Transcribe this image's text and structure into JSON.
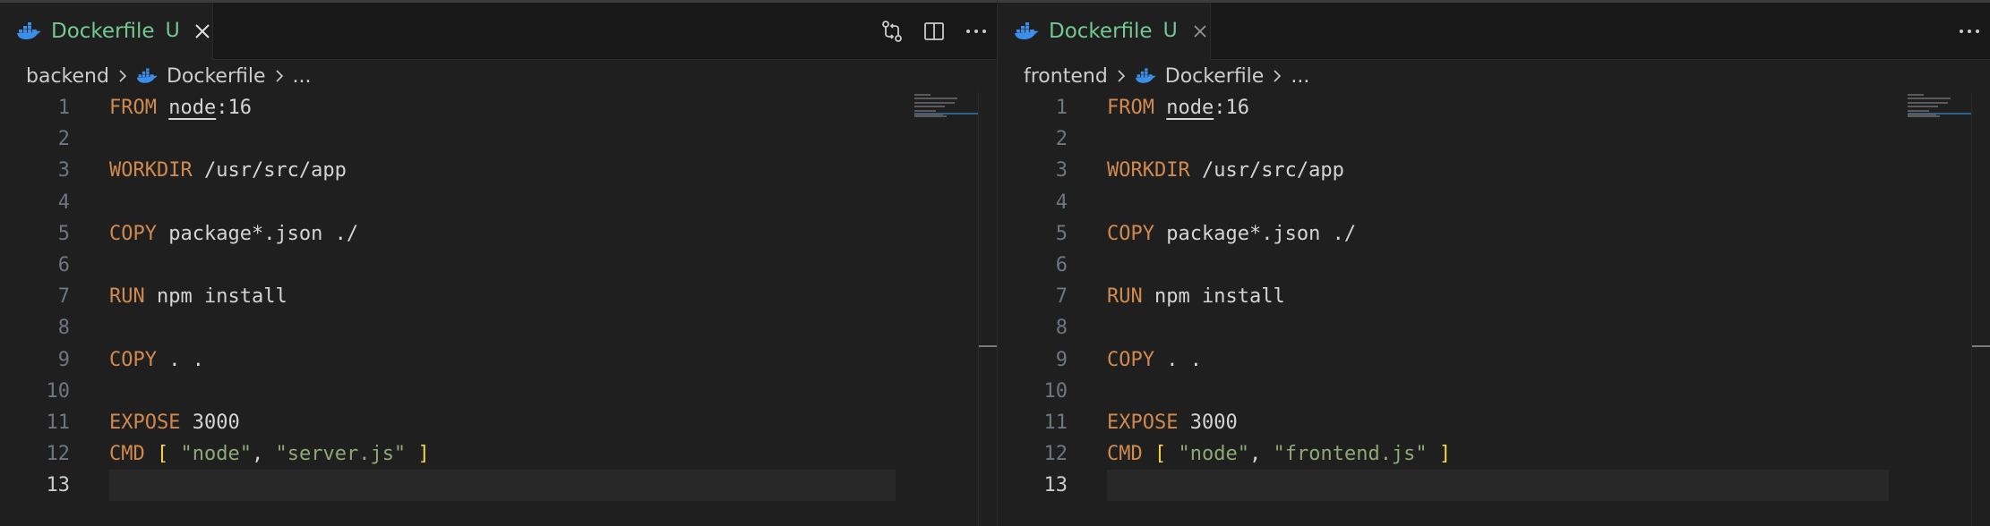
{
  "panes": [
    {
      "tab": {
        "label": "Dockerfile",
        "status": "U",
        "close": "×",
        "icon": "docker-icon"
      },
      "actions": [
        "compare-changes-icon",
        "split-editor-icon",
        "more-actions-icon"
      ],
      "breadcrumbs": {
        "folder": "backend",
        "file": "Dockerfile",
        "ellipsis": "..."
      },
      "lines": [
        {
          "n": "1",
          "kw": "FROM",
          "rest": "",
          "under": "node",
          "tail": ":16"
        },
        {
          "n": "2"
        },
        {
          "n": "3",
          "kw": "WORKDIR",
          "rest": " /usr/src/app"
        },
        {
          "n": "4"
        },
        {
          "n": "5",
          "kw": "COPY",
          "rest": " package*.json ./"
        },
        {
          "n": "6"
        },
        {
          "n": "7",
          "kw": "RUN",
          "rest": " npm install"
        },
        {
          "n": "8"
        },
        {
          "n": "9",
          "kw": "COPY",
          "rest": " . ."
        },
        {
          "n": "10"
        },
        {
          "n": "11",
          "kw": "EXPOSE",
          "rest": " 3000"
        },
        {
          "n": "12",
          "kw": "CMD",
          "cmd": true,
          "s1": "\"node\"",
          "s2": "\"server.js\""
        },
        {
          "n": "13",
          "current": true
        }
      ]
    },
    {
      "tab": {
        "label": "Dockerfile",
        "status": "U",
        "close": "×",
        "icon": "docker-icon"
      },
      "actions": [
        "more-actions-icon"
      ],
      "breadcrumbs": {
        "folder": "frontend",
        "file": "Dockerfile",
        "ellipsis": "..."
      },
      "lines": [
        {
          "n": "1",
          "kw": "FROM",
          "rest": "",
          "under": "node",
          "tail": ":16"
        },
        {
          "n": "2"
        },
        {
          "n": "3",
          "kw": "WORKDIR",
          "rest": " /usr/src/app"
        },
        {
          "n": "4"
        },
        {
          "n": "5",
          "kw": "COPY",
          "rest": " package*.json ./"
        },
        {
          "n": "6"
        },
        {
          "n": "7",
          "kw": "RUN",
          "rest": " npm install"
        },
        {
          "n": "8"
        },
        {
          "n": "9",
          "kw": "COPY",
          "rest": " . ."
        },
        {
          "n": "10"
        },
        {
          "n": "11",
          "kw": "EXPOSE",
          "rest": " 3000"
        },
        {
          "n": "12",
          "kw": "CMD",
          "cmd": true,
          "s1": "\"node\"",
          "s2": "\"frontend.js\""
        },
        {
          "n": "13",
          "current": true
        }
      ]
    }
  ],
  "colors": {
    "keyword": "#d08a4f",
    "string": "#8fa876",
    "bracket": "#f5d442",
    "untracked": "#73c991",
    "docker": "#3b8eea"
  }
}
